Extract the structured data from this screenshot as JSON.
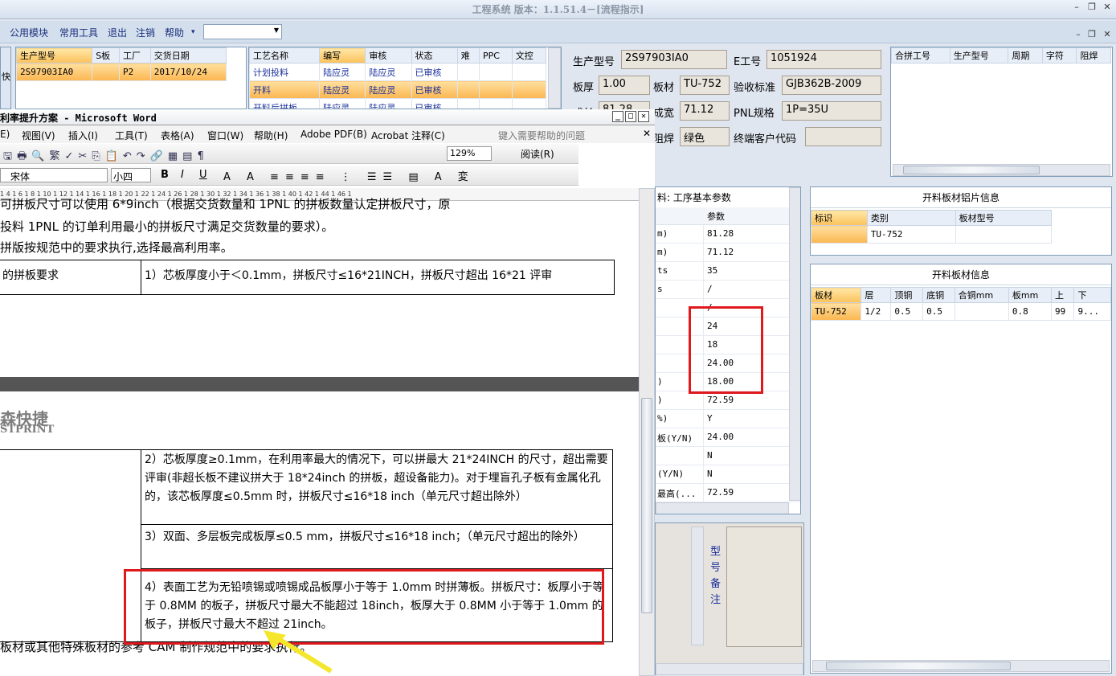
{
  "app": {
    "title": "工程系统 版本：1.1.51.4－[流程指示]"
  },
  "menubar": {
    "items": [
      "公用模块",
      "常用工具",
      "退出",
      "注销",
      "帮助"
    ],
    "help_arrow": "▾",
    "combo_value": ""
  },
  "order_table": {
    "headers": [
      "生产型号",
      "S板",
      "工厂",
      "交货日期"
    ],
    "row": [
      "2S97903IA0",
      "",
      "P2",
      "2017/10/24"
    ],
    "side_label": "快"
  },
  "process_table": {
    "headers": [
      "工艺名称",
      "编写",
      "审核",
      "状态",
      "难",
      "PPC",
      "文控"
    ],
    "rows": [
      [
        "计划投料",
        "陆应灵",
        "陆应灵",
        "已审核"
      ],
      [
        "开料",
        "陆应灵",
        "陆应灵",
        "已审核"
      ],
      [
        "开料后拼板",
        "陆应灵",
        "陆应灵",
        "已审核"
      ]
    ]
  },
  "info": {
    "prod_label": "生产型号",
    "prod_value": "2S97903IA0",
    "e_label": "E工号",
    "e_value": "1051924",
    "thick_label": "板厚",
    "thick_value": "1.00",
    "mat_label": "板材",
    "mat_value": "TU-752",
    "std_label": "验收标准",
    "std_value": "GJB362B-2009",
    "len_label": "成长",
    "len_value": "81.28",
    "width_label": "成宽",
    "width_value": "71.12",
    "pnl_label": "PNL规格",
    "pnl_value": "1P=35U",
    "mask_label": "阻焊",
    "mask_value": "绿色",
    "cust_label": "终端客户代码",
    "cust_value": ""
  },
  "merge_table": {
    "headers": [
      "合拼工号",
      "生产型号",
      "周期",
      "字符",
      "阻焊"
    ]
  },
  "params": {
    "title": "料: 工序基本参数",
    "header": "参数",
    "labels": [
      "m)",
      "m)",
      "ts",
      "s",
      "",
      "",
      "",
      "",
      ")",
      ")",
      "%)",
      "板(Y/N)",
      "",
      "(Y/N)",
      "最高(...",
      "%)"
    ],
    "values": [
      "81.28",
      "71.12",
      "35",
      "/",
      "/",
      "24",
      "18",
      "24.00",
      "18.00",
      "72.59",
      "Y",
      "24.00",
      "N",
      "N",
      "72.59"
    ]
  },
  "cutting_sheet": {
    "title": "开料板材铝片信息",
    "headers": [
      "标识",
      "类别",
      "板材型号"
    ],
    "row": [
      "",
      "TU-752",
      ""
    ]
  },
  "cutting_info": {
    "title": "开料板材信息",
    "headers": [
      "板材",
      "层",
      "顶铜",
      "底铜",
      "合铜mm",
      "板mm",
      "上",
      "下"
    ],
    "row": [
      "TU-752",
      "1/2",
      "0.5",
      "0.5",
      "",
      "0.8",
      "99",
      "9..."
    ]
  },
  "remark": {
    "chars": [
      "型",
      "号",
      "备",
      "注"
    ]
  },
  "word": {
    "title": "利率提升方案 - Microsoft Word",
    "menus": [
      "E)",
      "视图(V)",
      "插入(I)",
      "工具(T)",
      "表格(A)",
      "窗口(W)",
      "帮助(H)",
      "Adobe PDF(B)",
      "Acrobat 注释(C)"
    ],
    "help_box": "键入需要帮助的问题",
    "font_name": "宋体",
    "font_size": "小四",
    "zoom": "129%",
    "read_label": "阅读(R)",
    "ruler": "1 4 1 6 1 8 1 10 1 12 1 14 1 16 1 18 1 20 1 22 1 24 1 26 1 28 1 30 1 32 1 34 1 36 1 38 1 40 1 42 1 44 1 46 1"
  },
  "document": {
    "line1": "可拼板尺寸可以使用 6*9inch（根据交货数量和 1PNL 的拼板数量认定拼板尺寸，原",
    "line2": "投料 1PNL 的订单利用最小的拼板尺寸满足交货数量的要求）。",
    "line3": "拼版按规范中的要求执行,选择最高利用率。",
    "cell_left": "的拼板要求",
    "rule1": "1）芯板厚度小于＜0.1mm，拼板尺寸≤16*21INCH，拼板尺寸超出 16*21 评审",
    "logo1": "森快捷",
    "logo2": "STPRINT",
    "rule2": "2）芯板厚度≥0.1mm，在利用率最大的情况下，可以拼最大 21*24INCH 的尺寸，超出需要评审(非超长板不建议拼大于 18*24inch 的拼板，超设备能力)。对于埋盲孔子板有金属化孔的，该芯板厚度≤0.5mm 时，拼板尺寸≤16*18 inch（单元尺寸超出除外）",
    "rule3": "3）双面、多层板完成板厚≤0.5 mm，拼板尺寸≤16*18 inch；（单元尺寸超出的除外）",
    "rule4": "4）表面工艺为无铅喷锡或喷锡成品板厚小于等于 1.0mm 时拼薄板。拼板尺寸：板厚小于等于 0.8MM 的板子，拼板尺寸最大不能超过 18inch，板厚大于 0.8MM 小于等于 1.0mm 的板子，拼板尺寸最大不超过 21inch。",
    "footer": "板材或其他特殊板材的参考 CAM 制作规范中的要求执行。"
  },
  "colors": {
    "highlight": "#fbc25a",
    "annotation": "#e0191d",
    "arrow": "#f4e62a"
  }
}
